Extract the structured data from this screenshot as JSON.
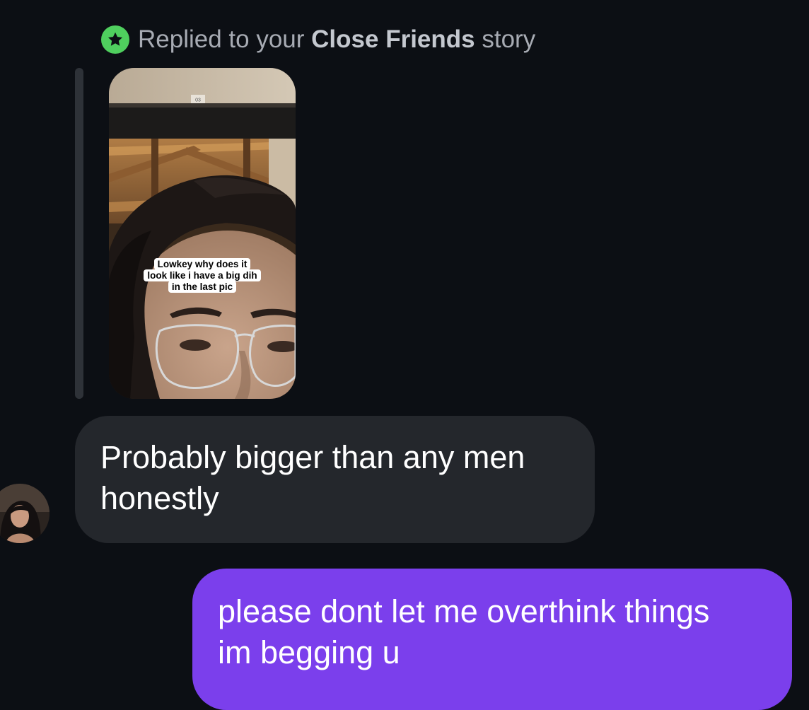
{
  "reply_header": {
    "prefix": "Replied to your",
    "highlight": "Close Friends",
    "suffix": "story",
    "icon": "star-icon",
    "icon_color": "#4fcf5e"
  },
  "story": {
    "sticker_lines": [
      "Lowkey why does it",
      "look like i have a big dih",
      "in the last pic"
    ],
    "sign_text": "03"
  },
  "messages": [
    {
      "direction": "incoming",
      "lines": [
        "Probably bigger than any men",
        "honestly"
      ],
      "bubble_color": "#24272c"
    },
    {
      "direction": "outgoing",
      "lines": [
        "please dont let me overthink things",
        "im begging u"
      ],
      "bubble_color": "#7b3fec"
    }
  ],
  "colors": {
    "background": "#0c0f14",
    "text": "#ffffff",
    "muted_text": "#a7abb3"
  }
}
